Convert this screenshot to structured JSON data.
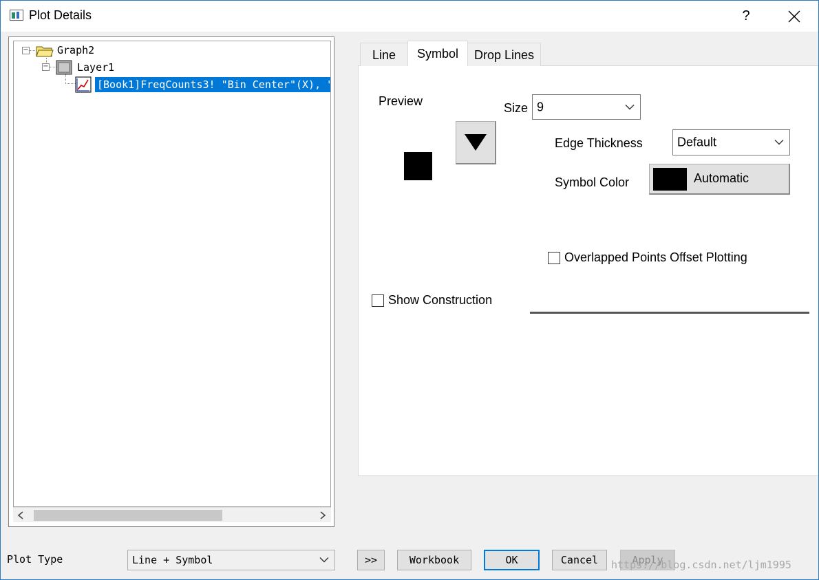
{
  "window": {
    "title": "Plot Details",
    "help_label": "?"
  },
  "tree": {
    "nodes": [
      {
        "label": "Graph2",
        "icon": "folder-icon"
      },
      {
        "label": "Layer1",
        "icon": "layer-icon"
      },
      {
        "label": "[Book1]FreqCounts3! \"Bin Center\"(X), \"",
        "icon": "plot-icon",
        "selected": true
      }
    ]
  },
  "tabs": [
    {
      "label": "Line",
      "active": false
    },
    {
      "label": "Symbol",
      "active": true
    },
    {
      "label": "Drop Lines",
      "active": false
    }
  ],
  "symbol": {
    "preview_label": "Preview",
    "size_label": "Size",
    "size_value": "9",
    "edge_thickness_label": "Edge Thickness",
    "edge_thickness_value": "Default",
    "symbol_color_label": "Symbol Color",
    "symbol_color_value": "Automatic",
    "symbol_color_swatch": "#000000",
    "overlapped_label": "Overlapped Points Offset Plotting",
    "overlapped_checked": false,
    "show_construction_label": "Show Construction",
    "show_construction_checked": false
  },
  "bottom": {
    "plot_type_label": "Plot Type",
    "plot_type_value": "Line + Symbol",
    "expand_label": ">>",
    "workbook_label": "Workbook",
    "ok_label": "OK",
    "cancel_label": "Cancel",
    "apply_label": "Apply",
    "watermark": "https://blog.csdn.net/ljm1995"
  },
  "colors": {
    "selection": "#0078d7",
    "window_border": "#2b78c5"
  }
}
